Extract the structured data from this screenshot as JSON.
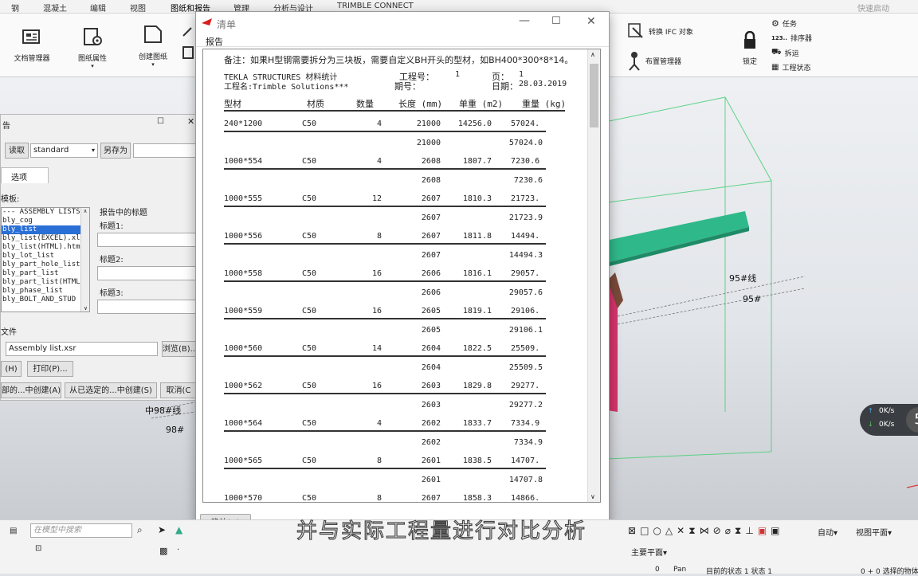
{
  "menubar": {
    "items": [
      "钢",
      "混凝土",
      "编辑",
      "视图",
      "图纸和报告",
      "管理",
      "分析与设计",
      "TRIMBLE CONNECT"
    ],
    "active_index": 4,
    "quick_launch_placeholder": "快速启动"
  },
  "ribbon": {
    "doc_manager": "文档管理器",
    "drawing_props": "图纸属性",
    "create_drawing": "创建图纸",
    "convert_ifc": "转换 IFC 对象",
    "layout_manager": "布置管理器",
    "lock": "锁定",
    "task": "任务",
    "sequencer": "排序器",
    "dismantle": "拆运",
    "project_status": "工程状态"
  },
  "report_panel": {
    "title": "告",
    "read": "读取",
    "standard": "standard",
    "save_as": "另存为",
    "options_tab": "选项",
    "template_label": "模板:",
    "templates": [
      "--- ASSEMBLY LISTS",
      "bly_cog",
      "bly_list",
      "bly_list(EXCEL).xl",
      "bly_list(HTML).htm",
      "bly_lot_list",
      "bly_part_hole_list",
      "bly_part_list",
      "bly_part_list(HTML",
      "bly_phase_list",
      "bly_BOLT_AND_STUD"
    ],
    "selected_index": 2,
    "titles_heading": "报告中的标题",
    "title1": "标题1:",
    "title2": "标题2:",
    "title3": "标题3:",
    "file_label": "文件",
    "file_value": "Assembly list.xsr",
    "browse": "浏览(B)...",
    "help_btn": "(H)",
    "print_btn": "打印(P)...",
    "create_all": "部的...中创建(A)",
    "create_selected": "从已选定的...中创建(S)",
    "cancel": "取消(C"
  },
  "dialog": {
    "title": "清单",
    "menu_report": "报告",
    "ok_button": "确认(O)",
    "note": "备注：如果H型钢需要拆分为三块板，需要自定义BH开头的型材，如BH400*300*8*14。",
    "header": {
      "software": "TEKLA STRUCTURES 材料统计",
      "project_no_label": "工程号：",
      "project_no": "1",
      "page_label": "页：",
      "page": "1",
      "project_name": "工程名:Trimble Solutions***",
      "period_label": "期号：",
      "date_label": "日期：",
      "date": "28.03.2019"
    },
    "columns": [
      "型材",
      "材质",
      "数量",
      "长度 (mm)",
      "单重 (m2)",
      "重量 (kg)"
    ],
    "rows": [
      {
        "profile": "240*1200",
        "material": "C50",
        "qty": "4",
        "length": "21000",
        "unit": "14256.0",
        "weight": "57024."
      },
      {
        "subtotal_length": "21000",
        "subtotal_weight": "57024.0"
      },
      {
        "profile": "1000*554",
        "material": "C50",
        "qty": "4",
        "length": "2608",
        "unit": "1807.7",
        "weight": "7230.6"
      },
      {
        "subtotal_length": "2608",
        "subtotal_weight": "7230.6"
      },
      {
        "profile": "1000*555",
        "material": "C50",
        "qty": "12",
        "length": "2607",
        "unit": "1810.3",
        "weight": "21723."
      },
      {
        "subtotal_length": "2607",
        "subtotal_weight": "21723.9"
      },
      {
        "profile": "1000*556",
        "material": "C50",
        "qty": "8",
        "length": "2607",
        "unit": "1811.8",
        "weight": "14494."
      },
      {
        "subtotal_length": "2607",
        "subtotal_weight": "14494.3"
      },
      {
        "profile": "1000*558",
        "material": "C50",
        "qty": "16",
        "length": "2606",
        "unit": "1816.1",
        "weight": "29057."
      },
      {
        "subtotal_length": "2606",
        "subtotal_weight": "29057.6"
      },
      {
        "profile": "1000*559",
        "material": "C50",
        "qty": "16",
        "length": "2605",
        "unit": "1819.1",
        "weight": "29106."
      },
      {
        "subtotal_length": "2605",
        "subtotal_weight": "29106.1"
      },
      {
        "profile": "1000*560",
        "material": "C50",
        "qty": "14",
        "length": "2604",
        "unit": "1822.5",
        "weight": "25509."
      },
      {
        "subtotal_length": "2604",
        "subtotal_weight": "25509.5"
      },
      {
        "profile": "1000*562",
        "material": "C50",
        "qty": "16",
        "length": "2603",
        "unit": "1829.8",
        "weight": "29277."
      },
      {
        "subtotal_length": "2603",
        "subtotal_weight": "29277.2"
      },
      {
        "profile": "1000*564",
        "material": "C50",
        "qty": "4",
        "length": "2602",
        "unit": "1833.7",
        "weight": "7334.9"
      },
      {
        "subtotal_length": "2602",
        "subtotal_weight": "7334.9"
      },
      {
        "profile": "1000*565",
        "material": "C50",
        "qty": "8",
        "length": "2601",
        "unit": "1838.5",
        "weight": "14707."
      },
      {
        "subtotal_length": "2601",
        "subtotal_weight": "14707.8"
      },
      {
        "profile": "1000*570",
        "material": "C50",
        "qty": "8",
        "length": "2607",
        "unit": "1858.3",
        "weight": "14866."
      }
    ]
  },
  "viewport": {
    "grid_label_95_line": "95#线",
    "grid_label_95": "95#",
    "grid_label_98_line": "中98#线",
    "grid_label_98": "98#",
    "net_up": "0K/s",
    "net_down": "0K/s",
    "net_badge": "5",
    "beam_color": "#2fb98a"
  },
  "bottom": {
    "search_placeholder": "在模型中搜索",
    "auto": "自动▾",
    "view_plane": "视图平面▾",
    "main_plane": "主要平面▾",
    "status_zero": "0",
    "pan": "Pan",
    "current_status": "目前的状态 1  状态 1",
    "selection": "0 + 0 选择的物体"
  },
  "subtitle": "并与实际工程量进行对比分析"
}
